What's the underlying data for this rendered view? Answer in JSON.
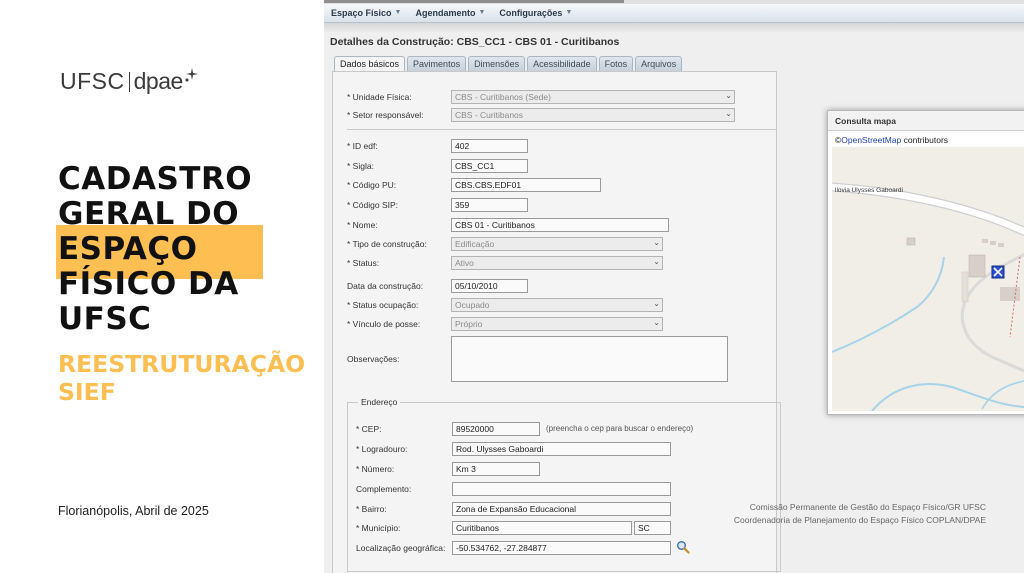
{
  "brand": {
    "ufsc": "UFSC",
    "dpae": "dpae"
  },
  "slide": {
    "title_lines": [
      "CADASTRO",
      "GERAL DO",
      "ESPAÇO",
      "FÍSICO DA",
      "UFSC"
    ],
    "subtitle_lines": [
      "REESTRUTURAÇÃO",
      "SIEF"
    ],
    "date": "Florianópolis, Abril de 2025",
    "accent_color": "#fdbe52"
  },
  "menu": [
    {
      "label": "Espaço Físico"
    },
    {
      "label": "Agendamento"
    },
    {
      "label": "Configurações"
    }
  ],
  "page": {
    "title": "Detalhes da Construção: CBS_CC1 - CBS 01 - Curitibanos"
  },
  "tabs": [
    {
      "label": "Dados básicos"
    },
    {
      "label": "Pavimentos"
    },
    {
      "label": "Dimensões"
    },
    {
      "label": "Acessibilidade"
    },
    {
      "label": "Fotos"
    },
    {
      "label": "Arquivos"
    }
  ],
  "form": {
    "unidade_fisica": {
      "label": "* Unidade Física:",
      "value": "CBS - Curitibanos (Sede)"
    },
    "setor": {
      "label": "* Setor responsável:",
      "value": "CBS - Curitibanos"
    },
    "id_edf": {
      "label": "* ID edf:",
      "value": "402"
    },
    "sigla": {
      "label": "* Sigla:",
      "value": "CBS_CC1"
    },
    "codigo_pu": {
      "label": "* Código PU:",
      "value": "CBS.CBS.EDF01"
    },
    "codigo_sip": {
      "label": "* Código SIP:",
      "value": "359"
    },
    "nome": {
      "label": "* Nome:",
      "value": "CBS 01 - Curitibanos"
    },
    "tipo": {
      "label": "* Tipo de construção:",
      "value": "Edificação"
    },
    "status": {
      "label": "* Status:",
      "value": "Ativo"
    },
    "data": {
      "label": "Data da construção:",
      "value": "05/10/2010"
    },
    "status_ocupacao": {
      "label": "* Status ocupação:",
      "value": "Ocupado"
    },
    "vinculo": {
      "label": "* Vínculo de posse:",
      "value": "Próprio"
    },
    "observacoes": {
      "label": "Observações:",
      "value": ""
    }
  },
  "endereco": {
    "legend": "Endereço",
    "cep": {
      "label": "* CEP:",
      "value": "89520000",
      "hint": "(preencha o cep para buscar o endereço)"
    },
    "logradouro": {
      "label": "* Logradouro:",
      "value": "Rod. Ulysses Gaboardi"
    },
    "numero": {
      "label": "* Número:",
      "value": "Km 3"
    },
    "complemento": {
      "label": "Complemento:",
      "value": ""
    },
    "bairro": {
      "label": "* Bairro:",
      "value": "Zona de Expansão Educacional"
    },
    "municipio": {
      "label": "* Município:",
      "value": "Curitibanos",
      "uf": "SC"
    },
    "localizacao": {
      "label": "Localização geográfica:",
      "value": "-50.534762, -27.284877"
    }
  },
  "footer": {
    "line1": "Comissão Permanente de Gestão do Espaço Físico/GR UFSC",
    "line2": "Coordenadoria de Planejamento do Espaço Físico COPLAN/DPAE"
  },
  "map": {
    "title": "Consulta mapa",
    "attribution_prefix": "©",
    "attribution_link": "OpenStreetMap",
    "attribution_suffix": " contributors",
    "street_label": "llovia Ulysses Gaboardi"
  }
}
